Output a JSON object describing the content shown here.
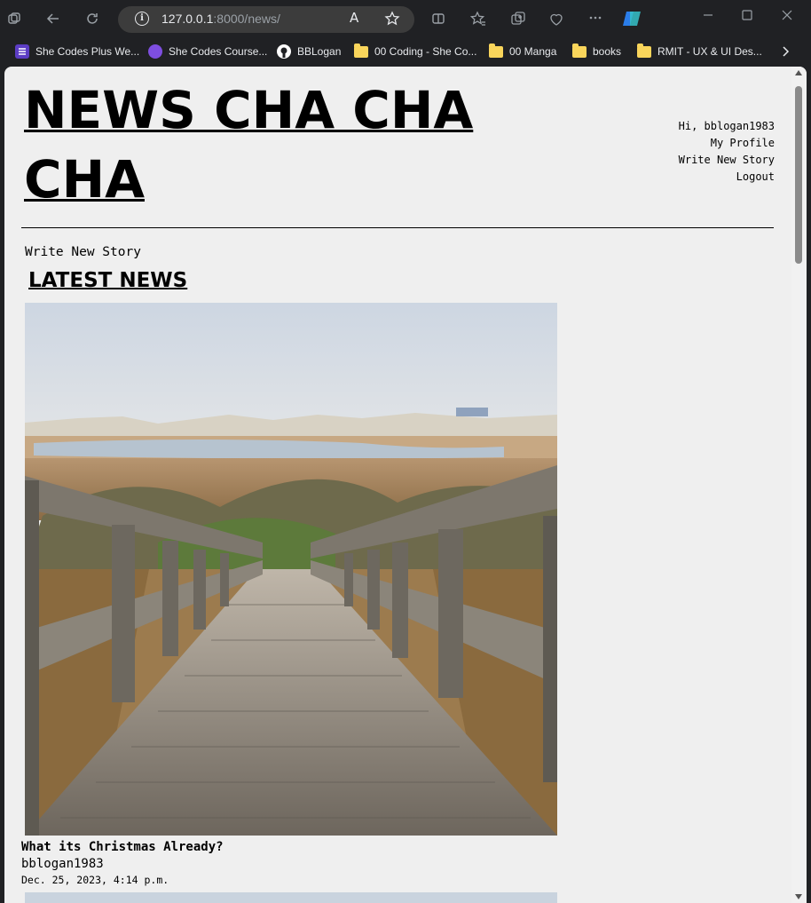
{
  "browser": {
    "url_host": "127.0.0.1",
    "url_path": ":8000/news/",
    "read_aloud_label": "A",
    "bookmarks": [
      {
        "label": "She Codes Plus We...",
        "icon": "list-icon",
        "color": "#5c3dc4"
      },
      {
        "label": "She Codes Course...",
        "icon": "circle-icon",
        "color": "#7e4ee0"
      },
      {
        "label": "BBLogan",
        "icon": "github-icon",
        "color": "#ffffff"
      },
      {
        "label": "00 Coding - She Co...",
        "icon": "folder-icon",
        "color": "#f9d55b"
      },
      {
        "label": "00 Manga",
        "icon": "folder-icon",
        "color": "#f9d55b"
      },
      {
        "label": "books",
        "icon": "folder-icon",
        "color": "#f9d55b"
      },
      {
        "label": "RMIT - UX & UI Des...",
        "icon": "folder-icon",
        "color": "#f9d55b"
      }
    ]
  },
  "site": {
    "title": "NEWS CHA CHA CHA",
    "nav": {
      "greeting": "Hi, bblogan1983",
      "profile": "My Profile",
      "write": "Write New Story",
      "logout": "Logout"
    },
    "write_link": "Write New Story",
    "section_heading": "LATEST NEWS"
  },
  "stories": [
    {
      "title": "What its Christmas Already?",
      "author": "bblogan1983",
      "date": "Dec. 25, 2023, 4:14 p.m."
    }
  ]
}
